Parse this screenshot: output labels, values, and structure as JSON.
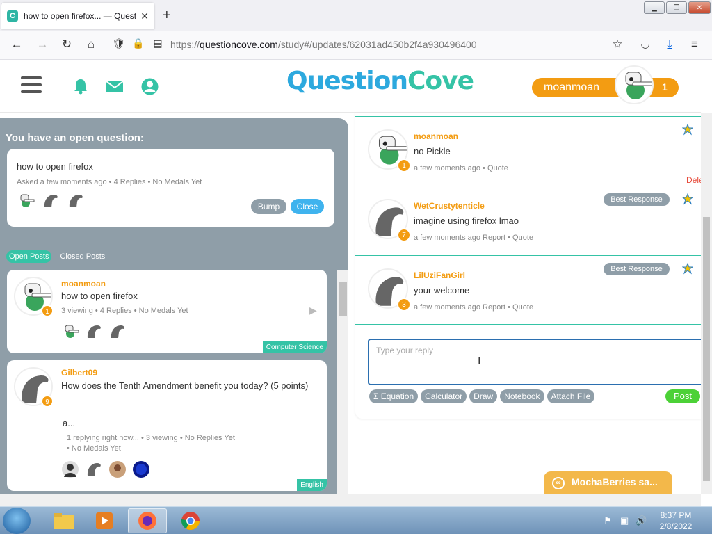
{
  "browser": {
    "tab_title": "how to open firefox... — Questi",
    "tab_favicon": "C",
    "new_tab_symbol": "+",
    "url_prefix": "https://",
    "url_domain": "questioncove.com",
    "url_path": "/study#/updates/62031ad450b2f4a930496400"
  },
  "site": {
    "logo_q": "Question",
    "logo_cove": "Cove",
    "username": "moanmoan",
    "user_count": "1"
  },
  "open_question": {
    "title": "You have an open question:",
    "question": "how to open firefox",
    "meta": "Asked a few moments ago  •  4 Replies  •  No Medals Yet",
    "bump_label": "Bump",
    "close_label": "Close"
  },
  "post_tabs": {
    "open": "Open Posts",
    "closed": "Closed Posts"
  },
  "posts": [
    {
      "user": "moanmoan",
      "badge": "1",
      "text": "how to open firefox",
      "meta": "3 viewing  •  4 Replies  •  No Medals Yet",
      "subject": "Computer Science"
    },
    {
      "user": "Gilbert09",
      "badge": "9",
      "text": "How does the Tenth Amendment benefit you today? (5 points)",
      "excerpt": "a...",
      "meta1": "1 replying right now...  •  3 viewing  •  No Replies Yet",
      "meta2": "•  No Medals Yet",
      "subject": "English"
    }
  ],
  "replies": [
    {
      "user": "moanmoan",
      "badge": "1",
      "text": "no Pickle",
      "meta": "a few moments ago  •  Quote",
      "side_text": "Dele"
    },
    {
      "user": "WetCrustytenticle",
      "badge": "7",
      "text": "imagine using firefox lmao",
      "meta": "a few moments ago   Report  •  Quote",
      "best_label": "Best Response"
    },
    {
      "user": "LilUziFanGirl",
      "badge": "3",
      "text": "your welcome",
      "meta": "a few moments ago   Report  •  Quote",
      "best_label": "Best Response"
    }
  ],
  "reply_box": {
    "placeholder": "Type your reply"
  },
  "tools": {
    "equation": "Σ  Equation",
    "calculator": "Calculator",
    "draw": "Draw",
    "notebook": "Notebook",
    "attach": "Attach File",
    "post": "Post"
  },
  "chat": {
    "label": "MochaBerries sa..."
  },
  "taskbar": {
    "time": "8:37 PM",
    "date": "2/8/2022"
  },
  "colors": {
    "accent_orange": "#f39c12",
    "teal": "#35c3a6",
    "blue": "#3fb3ee",
    "panel_gray": "#8f9ea8",
    "post_green": "#4cd137"
  }
}
